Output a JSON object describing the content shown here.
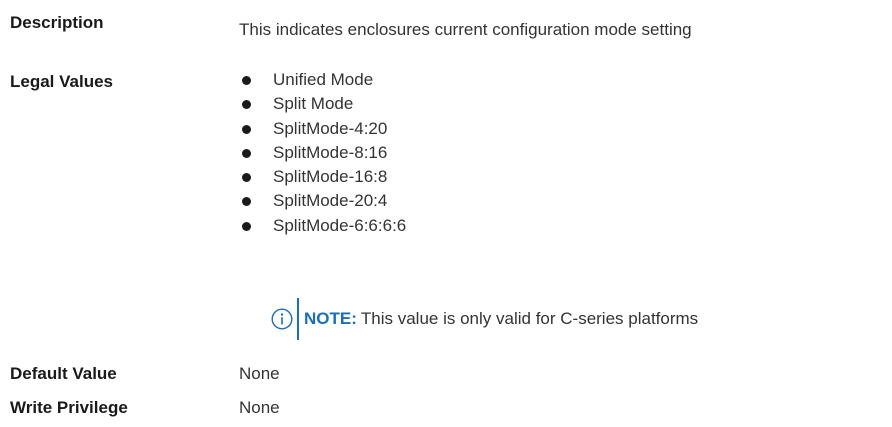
{
  "description": {
    "label": "Description",
    "value": "This indicates enclosures current configuration mode setting"
  },
  "legal_values": {
    "label": "Legal Values",
    "items": [
      "Unified Mode",
      "Split Mode",
      "SplitMode-4:20",
      "SplitMode-8:16",
      "SplitMode-16:8",
      "SplitMode-20:4",
      "SplitMode-6:6:6:6"
    ],
    "note": {
      "icon": "info-icon",
      "title": "NOTE:",
      "text": "This value is only valid for C-series platforms"
    }
  },
  "default_value": {
    "label": "Default Value",
    "value": "None"
  },
  "write_privilege": {
    "label": "Write Privilege",
    "value": "None"
  },
  "colors": {
    "accent": "#1b6fb4",
    "text": "#333333",
    "label": "#1a1a1a"
  }
}
